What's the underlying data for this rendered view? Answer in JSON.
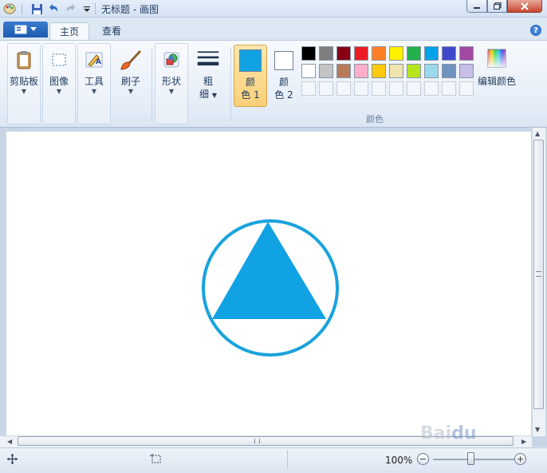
{
  "window": {
    "title": "无标题 - 画图"
  },
  "tabs": [
    {
      "label": "主页",
      "active": true
    },
    {
      "label": "查看",
      "active": false
    }
  ],
  "ribbon": {
    "clipboard_label": "剪贴板",
    "image_label": "图像",
    "tools_label": "工具",
    "brushes_label": "刷子",
    "shapes_label": "形状",
    "size_label": "粗\n细",
    "size_label_line1": "粗",
    "size_label_line2": "细",
    "color1_line1": "颜",
    "color1_line2": "色 1",
    "color2_line1": "颜",
    "color2_line2": "色 2",
    "edit_colors_label": "编辑颜色",
    "colors_group_label": "颜色",
    "color1_value": "#11a2e4",
    "color2_value": "#ffffff"
  },
  "palette": {
    "row1": [
      "#000000",
      "#7f7f7f",
      "#880015",
      "#ed1c24",
      "#ff7f27",
      "#fff200",
      "#22b14c",
      "#00a2e8",
      "#3f48cc",
      "#a349a4"
    ],
    "row2": [
      "#ffffff",
      "#c3c3c3",
      "#b97a57",
      "#ffaec9",
      "#ffc90e",
      "#efe4b0",
      "#b5e61d",
      "#99d9ea",
      "#7092be",
      "#c8bfe7"
    ]
  },
  "drawing": {
    "circle_color": "#19a3dc",
    "triangle_color": "#11a2e4"
  },
  "status": {
    "zoom": "100%"
  }
}
